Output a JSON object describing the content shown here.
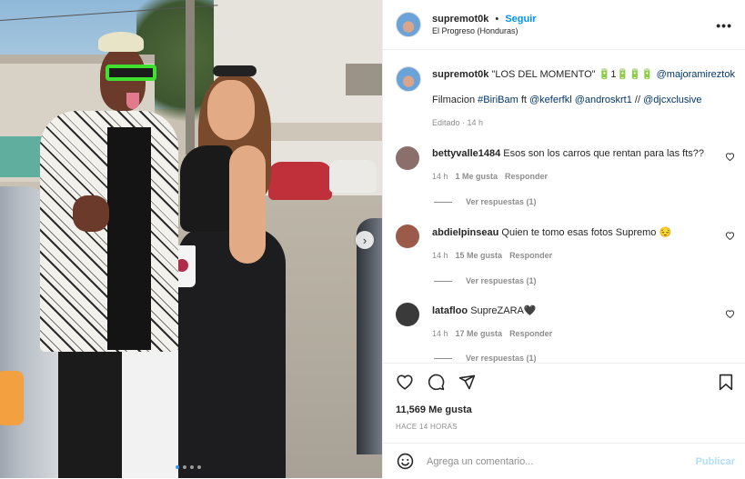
{
  "header": {
    "username": "supremot0k",
    "separator": "•",
    "follow_label": "Seguir",
    "location": "El Progreso (Honduras)",
    "more_label": "•••"
  },
  "caption": {
    "username": "supremot0k",
    "text": "\"LOS DEL MOMENTO\" 🔋1🔋🔋🔋",
    "mention": "@majoramireztok",
    "line2_prefix": "Filmacion",
    "hashtag": "#BiriBam",
    "line2_ft": "ft",
    "mention2": "@keferfkl",
    "mention3": "@androskrt1",
    "line2_sep": "//",
    "mention4": "@djcxclusive",
    "meta": "Editado · 14 h"
  },
  "comments": [
    {
      "username": "bettyvalle1484",
      "text": "Esos son los carros que rentan para las fts??",
      "time": "14 h",
      "likes": "1 Me gusta",
      "reply": "Responder",
      "view_replies": "Ver respuestas (1)",
      "avatar_color": "#8a6f6a"
    },
    {
      "username": "abdielpinseau",
      "text": "Quien te tomo esas fotos Supremo 😔",
      "time": "14 h",
      "likes": "15 Me gusta",
      "reply": "Responder",
      "view_replies": "Ver respuestas (1)",
      "avatar_color": "#9c5a4a"
    },
    {
      "username": "latafloo",
      "text": "SupreZARA🖤",
      "time": "14 h",
      "likes": "17 Me gusta",
      "reply": "Responder",
      "view_replies": "Ver respuestas (1)",
      "avatar_color": "#3a3a3a"
    }
  ],
  "actions": {
    "like_icon": "heart-outline-icon",
    "comment_icon": "comment-bubble-icon",
    "share_icon": "paper-plane-icon",
    "save_icon": "bookmark-icon",
    "likes_text": "11,569 Me gusta",
    "posted_time": "HACE 14 HORAS"
  },
  "add_comment": {
    "placeholder": "Agrega un comentario...",
    "publish_label": "Publicar",
    "emoji_icon": "smiley-icon"
  },
  "carousel": {
    "next_icon": "chevron-right-icon",
    "next_glyph": "›",
    "slide_count": 4,
    "active_slide": 1
  },
  "colors": {
    "link_blue": "#0095f6",
    "mention_blue": "#00376b",
    "muted_gray": "#8e8e8e",
    "publish_disabled": "#b2dffc"
  }
}
